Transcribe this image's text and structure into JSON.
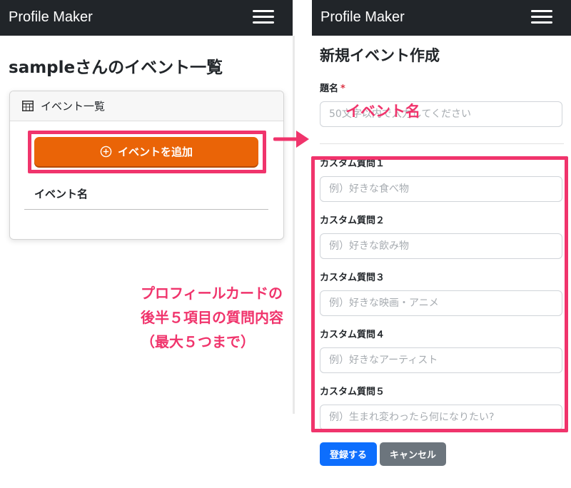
{
  "app": {
    "brand": "Profile Maker"
  },
  "left": {
    "page_title": "sampleさんのイベント一覧",
    "card_title": "イベント一覧",
    "add_button_label": "イベントを追加",
    "list_column_label": "イベント名"
  },
  "right": {
    "form_title": "新規イベント作成",
    "title_field": {
      "label": "題名",
      "required_mark": "*",
      "placeholder": "50文字以内で入力してください",
      "value": ""
    },
    "custom_questions": [
      {
        "label": "カスタム質問１",
        "placeholder": "例）好きな食べ物"
      },
      {
        "label": "カスタム質問２",
        "placeholder": "例）好きな飲み物"
      },
      {
        "label": "カスタム質問３",
        "placeholder": "例）好きな映画・アニメ"
      },
      {
        "label": "カスタム質問４",
        "placeholder": "例）好きなアーティスト"
      },
      {
        "label": "カスタム質問５",
        "placeholder": "例）生まれ変わったら何になりたい?"
      }
    ],
    "submit_label": "登録する",
    "cancel_label": "キャンセル"
  },
  "annotations": {
    "event_name": "イベント名",
    "custom_note": [
      "プロフィールカードの",
      "後半５項目の質問内容",
      "（最大５つまで）"
    ]
  },
  "colors": {
    "navbar": "#212529",
    "add_button": "#ea6407",
    "annotation": "#f0346c",
    "primary": "#0d6efd",
    "secondary": "#6c757d",
    "required": "#dc3545"
  },
  "icons": {
    "menu": "hamburger-menu-icon",
    "table": "table-icon",
    "add": "plus-circle-icon",
    "arrow": "right-arrow-icon"
  }
}
